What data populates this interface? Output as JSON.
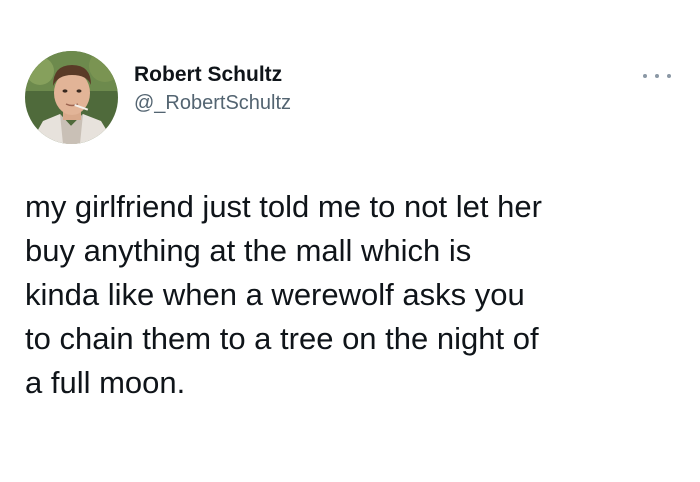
{
  "author": {
    "display_name": "Robert Schultz",
    "handle": "@_RobertSchultz",
    "avatar_icon": "profile-photo"
  },
  "actions": {
    "more_icon": "more-options-icon"
  },
  "tweet": {
    "text": "my girlfriend just told me to not let her\nbuy anything at the mall which is\nkinda like when a werewolf asks you\nto chain them to a tree on the night of\na full moon."
  },
  "colors": {
    "text": "#0f1419",
    "secondary": "#536471",
    "background": "#ffffff"
  }
}
